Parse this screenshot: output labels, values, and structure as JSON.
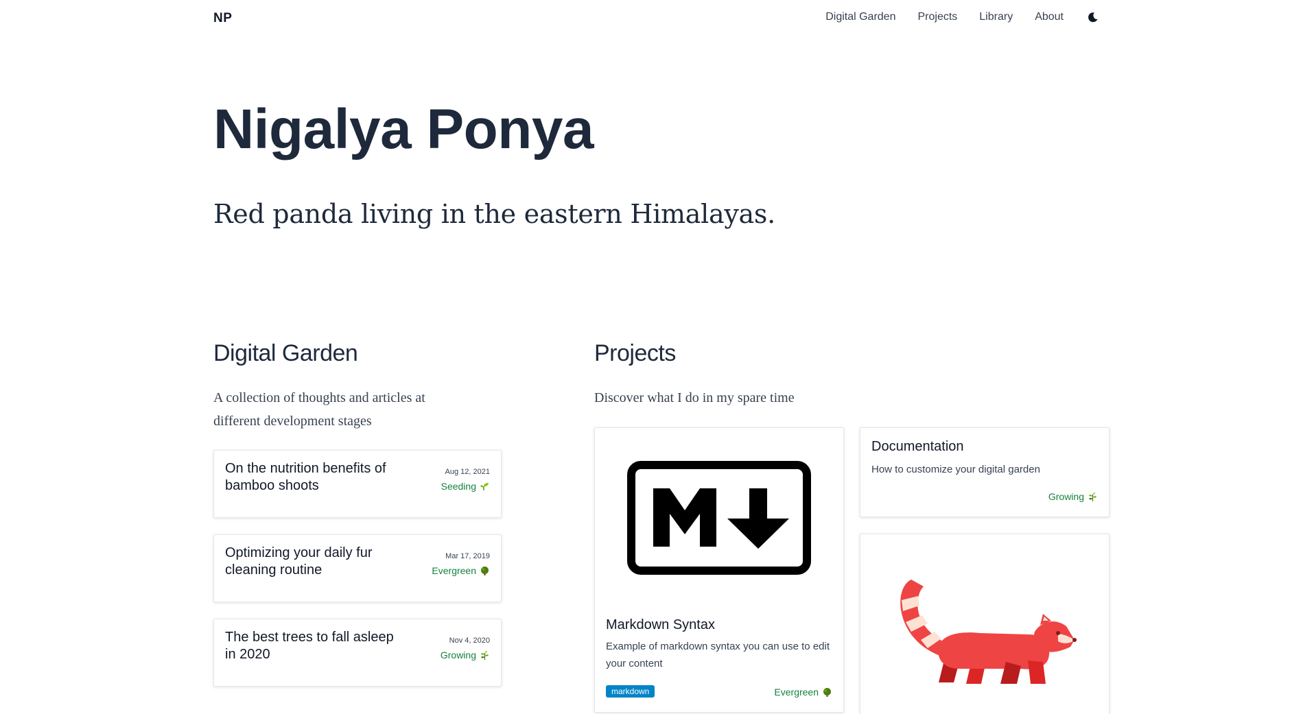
{
  "header": {
    "brand": "NP",
    "nav": [
      "Digital Garden",
      "Projects",
      "Library",
      "About"
    ],
    "theme_toggle_icon": "moon-icon"
  },
  "hero": {
    "title": "Nigalya Ponya",
    "subtitle": "Red panda living in the eastern Himalayas."
  },
  "garden": {
    "title": "Digital Garden",
    "description_line1": "A collection of thoughts and articles at",
    "description_line2": "different development stages",
    "items": [
      {
        "title": "On the nutrition benefits of bamboo shoots",
        "date": "Aug 12, 2021",
        "stage": "Seeding",
        "icon": "seedling-icon"
      },
      {
        "title": "Optimizing your daily fur cleaning routine",
        "date": "Mar 17, 2019",
        "stage": "Evergreen",
        "icon": "tree-icon"
      },
      {
        "title": "The best trees to fall asleep in 2020",
        "date": "Nov 4, 2020",
        "stage": "Growing",
        "icon": "herb-icon"
      }
    ]
  },
  "projects": {
    "title": "Projects",
    "description": "Discover what I do in my spare time",
    "items": [
      {
        "title": "Markdown Syntax",
        "description": "Example of markdown syntax you can use to edit your content",
        "tag": "markdown",
        "stage": "Evergreen",
        "icon": "tree-icon",
        "image": "markdown-logo-icon"
      },
      {
        "title": "Documentation",
        "description": "How to customize your digital garden",
        "stage": "Growing",
        "icon": "herb-icon"
      },
      {
        "image": "red-panda-icon"
      }
    ]
  },
  "colors": {
    "text": "#1e293b",
    "stage_green": "#15803d",
    "tag_blue": "#0284c7",
    "panda_red": "#ef4444"
  }
}
